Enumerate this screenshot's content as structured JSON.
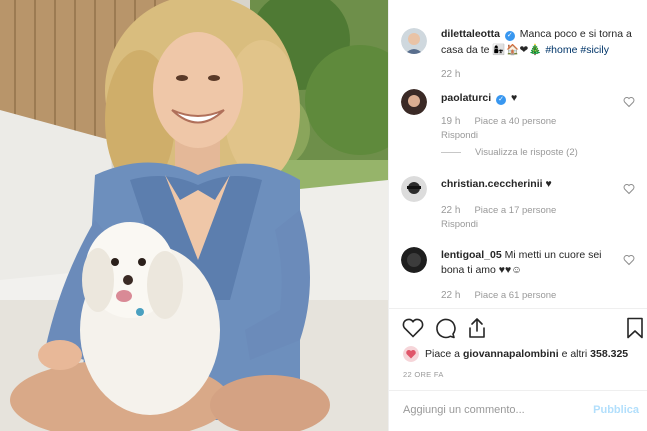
{
  "post": {
    "author": "dilettaleotta",
    "caption_text": "Manca poco e si torna a casa da te",
    "caption_emoji": "👩‍👧🏠❤🎄",
    "hashtags": [
      "#home",
      "#sicily"
    ],
    "time": "22 h"
  },
  "comments": [
    {
      "user": "paolaturci",
      "verified": true,
      "text": "♥",
      "time": "19 h",
      "likes": "Piace a 40 persone",
      "reply": "Rispondi",
      "view_replies": "Visualizza le risposte (2)"
    },
    {
      "user": "christian.ceccherinii",
      "verified": false,
      "text": "♥",
      "time": "22 h",
      "likes": "Piace a 17 persone",
      "reply": "Rispondi"
    },
    {
      "user": "lentigoal_05",
      "verified": false,
      "text": "Mi metti un cuore sei bona ti amo ♥♥☺",
      "time": "22 h",
      "likes": "Piace a 61 persone"
    }
  ],
  "likes_bar": {
    "prefix": "Piace a",
    "user": "giovannapalombini",
    "suffix": "e altri",
    "count": "358.325"
  },
  "posted_ago": "22 ORE FA",
  "comment_box": {
    "placeholder": "Aggiungi un commento...",
    "publish": "Pubblica"
  },
  "icons": {
    "like": "heart-icon",
    "comment": "comment-icon",
    "share": "share-icon",
    "save": "bookmark-icon"
  },
  "colors": {
    "link": "#003569",
    "verified": "#3897f0",
    "muted": "#999999",
    "publish_disabled": "#b2dffc"
  }
}
